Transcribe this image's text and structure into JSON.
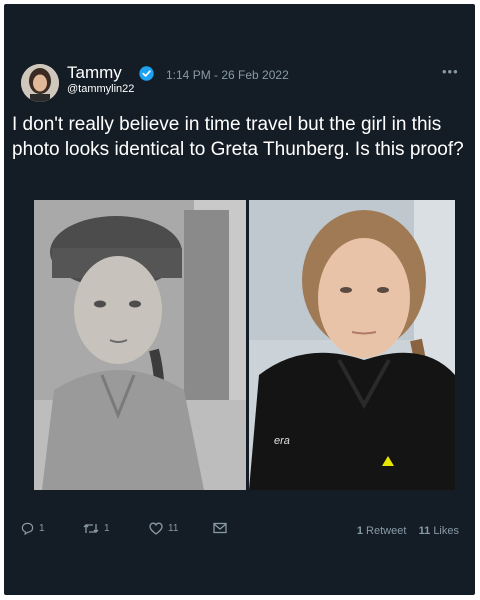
{
  "tweet": {
    "author_name": "Tammy",
    "author_handle": "@tammylin22",
    "timestamp": "1:14 PM - 26 Feb 2022",
    "more_label": "•••",
    "text": "I don't really believe in time travel but the girl in this photo looks identical to Greta Thunberg. Is this proof?",
    "photo_caption_jacket": "era"
  },
  "actions": {
    "reply_count": "1",
    "retweet_count": "1",
    "like_count": "11"
  },
  "stats": {
    "retweets_value": "1",
    "retweets_label": "Retweet",
    "likes_value": "11",
    "likes_label": "Likes"
  },
  "colors": {
    "background": "#141d26",
    "text": "#ffffff",
    "muted": "#8899a6",
    "verified": "#1da1f2"
  },
  "icons": [
    "verified-badge-icon",
    "more-icon",
    "reply-icon",
    "retweet-icon",
    "like-icon",
    "message-icon"
  ]
}
